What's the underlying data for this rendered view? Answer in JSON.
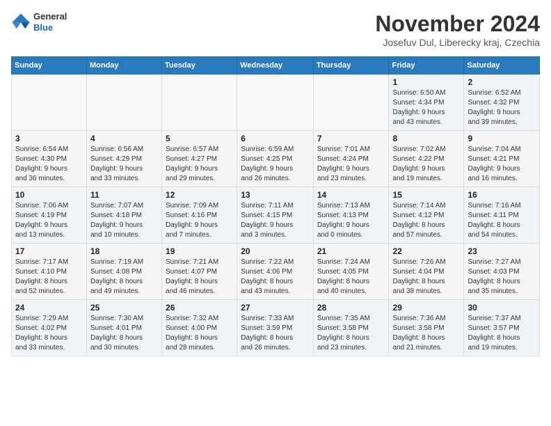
{
  "header": {
    "logo_general": "General",
    "logo_blue": "Blue",
    "month": "November 2024",
    "location": "Josefuv Dul, Liberecky kraj, Czechia"
  },
  "weekdays": [
    "Sunday",
    "Monday",
    "Tuesday",
    "Wednesday",
    "Thursday",
    "Friday",
    "Saturday"
  ],
  "weeks": [
    [
      {
        "day": "",
        "info": ""
      },
      {
        "day": "",
        "info": ""
      },
      {
        "day": "",
        "info": ""
      },
      {
        "day": "",
        "info": ""
      },
      {
        "day": "",
        "info": ""
      },
      {
        "day": "1",
        "info": "Sunrise: 6:50 AM\nSunset: 4:34 PM\nDaylight: 9 hours\nand 43 minutes."
      },
      {
        "day": "2",
        "info": "Sunrise: 6:52 AM\nSunset: 4:32 PM\nDaylight: 9 hours\nand 39 minutes."
      }
    ],
    [
      {
        "day": "3",
        "info": "Sunrise: 6:54 AM\nSunset: 4:30 PM\nDaylight: 9 hours\nand 36 minutes."
      },
      {
        "day": "4",
        "info": "Sunrise: 6:56 AM\nSunset: 4:29 PM\nDaylight: 9 hours\nand 33 minutes."
      },
      {
        "day": "5",
        "info": "Sunrise: 6:57 AM\nSunset: 4:27 PM\nDaylight: 9 hours\nand 29 minutes."
      },
      {
        "day": "6",
        "info": "Sunrise: 6:59 AM\nSunset: 4:25 PM\nDaylight: 9 hours\nand 26 minutes."
      },
      {
        "day": "7",
        "info": "Sunrise: 7:01 AM\nSunset: 4:24 PM\nDaylight: 9 hours\nand 23 minutes."
      },
      {
        "day": "8",
        "info": "Sunrise: 7:02 AM\nSunset: 4:22 PM\nDaylight: 9 hours\nand 19 minutes."
      },
      {
        "day": "9",
        "info": "Sunrise: 7:04 AM\nSunset: 4:21 PM\nDaylight: 9 hours\nand 16 minutes."
      }
    ],
    [
      {
        "day": "10",
        "info": "Sunrise: 7:06 AM\nSunset: 4:19 PM\nDaylight: 9 hours\nand 13 minutes."
      },
      {
        "day": "11",
        "info": "Sunrise: 7:07 AM\nSunset: 4:18 PM\nDaylight: 9 hours\nand 10 minutes."
      },
      {
        "day": "12",
        "info": "Sunrise: 7:09 AM\nSunset: 4:16 PM\nDaylight: 9 hours\nand 7 minutes."
      },
      {
        "day": "13",
        "info": "Sunrise: 7:11 AM\nSunset: 4:15 PM\nDaylight: 9 hours\nand 3 minutes."
      },
      {
        "day": "14",
        "info": "Sunrise: 7:13 AM\nSunset: 4:13 PM\nDaylight: 9 hours\nand 0 minutes."
      },
      {
        "day": "15",
        "info": "Sunrise: 7:14 AM\nSunset: 4:12 PM\nDaylight: 8 hours\nand 57 minutes."
      },
      {
        "day": "16",
        "info": "Sunrise: 7:16 AM\nSunset: 4:11 PM\nDaylight: 8 hours\nand 54 minutes."
      }
    ],
    [
      {
        "day": "17",
        "info": "Sunrise: 7:17 AM\nSunset: 4:10 PM\nDaylight: 8 hours\nand 52 minutes."
      },
      {
        "day": "18",
        "info": "Sunrise: 7:19 AM\nSunset: 4:08 PM\nDaylight: 8 hours\nand 49 minutes."
      },
      {
        "day": "19",
        "info": "Sunrise: 7:21 AM\nSunset: 4:07 PM\nDaylight: 8 hours\nand 46 minutes."
      },
      {
        "day": "20",
        "info": "Sunrise: 7:22 AM\nSunset: 4:06 PM\nDaylight: 8 hours\nand 43 minutes."
      },
      {
        "day": "21",
        "info": "Sunrise: 7:24 AM\nSunset: 4:05 PM\nDaylight: 8 hours\nand 40 minutes."
      },
      {
        "day": "22",
        "info": "Sunrise: 7:26 AM\nSunset: 4:04 PM\nDaylight: 8 hours\nand 38 minutes."
      },
      {
        "day": "23",
        "info": "Sunrise: 7:27 AM\nSunset: 4:03 PM\nDaylight: 8 hours\nand 35 minutes."
      }
    ],
    [
      {
        "day": "24",
        "info": "Sunrise: 7:29 AM\nSunset: 4:02 PM\nDaylight: 8 hours\nand 33 minutes."
      },
      {
        "day": "25",
        "info": "Sunrise: 7:30 AM\nSunset: 4:01 PM\nDaylight: 8 hours\nand 30 minutes."
      },
      {
        "day": "26",
        "info": "Sunrise: 7:32 AM\nSunset: 4:00 PM\nDaylight: 8 hours\nand 28 minutes."
      },
      {
        "day": "27",
        "info": "Sunrise: 7:33 AM\nSunset: 3:59 PM\nDaylight: 8 hours\nand 26 minutes."
      },
      {
        "day": "28",
        "info": "Sunrise: 7:35 AM\nSunset: 3:58 PM\nDaylight: 8 hours\nand 23 minutes."
      },
      {
        "day": "29",
        "info": "Sunrise: 7:36 AM\nSunset: 3:58 PM\nDaylight: 8 hours\nand 21 minutes."
      },
      {
        "day": "30",
        "info": "Sunrise: 7:37 AM\nSunset: 3:57 PM\nDaylight: 8 hours\nand 19 minutes."
      }
    ]
  ]
}
